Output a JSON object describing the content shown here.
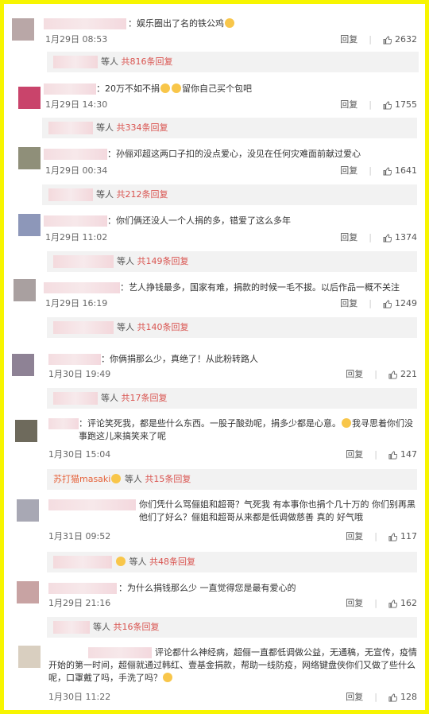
{
  "actions": {
    "reply_label": "回复"
  },
  "comments": [
    {
      "text": "：娱乐圈出了名的铁公鸡",
      "time": "1月29日 08:53",
      "likes": "2632",
      "reply_suffix": "等人",
      "reply_count": "共816条回复",
      "avatar_color": "#b9a7a7"
    },
    {
      "text": "：20万不如不捐",
      "text2": "留你自己买个包吧",
      "time": "1月29日 14:30",
      "likes": "1755",
      "reply_suffix": "等人",
      "reply_count": "共334条回复",
      "avatar_color": "#c9446b"
    },
    {
      "text": "：孙俪邓超这两口子扣的没点爱心，没见在任何灾难面前献过爱心",
      "time": "1月29日 00:34",
      "likes": "1641",
      "reply_suffix": "等人",
      "reply_count": "共212条回复",
      "avatar_color": "#8f8f79"
    },
    {
      "text": "：你们俩还没人一个人捐的多，错爱了这么多年",
      "time": "1月29日 11:02",
      "likes": "1374",
      "reply_suffix": "等人",
      "reply_count": "共149条回复",
      "avatar_color": "#8d97b9"
    },
    {
      "text": "：艺人挣钱最多，国家有难，捐款的时候一毛不拔。以后作品一概不关注",
      "time": "1月29日 16:19",
      "likes": "1249",
      "reply_suffix": "等人",
      "reply_count": "共140条回复",
      "avatar_color": "#a9a0a0"
    },
    {
      "text": "：你俩捐那么少，真绝了！从此粉转路人",
      "time": "1月30日 19:49",
      "likes": "221",
      "reply_suffix": "等人",
      "reply_count": "共17条回复",
      "avatar_color": "#8e8295"
    },
    {
      "text": "：评论笑死我，都是些什么东西。一股子酸劲呢，捐多少都是心意。",
      "text2": "我寻思着你们没事跑这儿来搞笑来了呢",
      "time": "1月30日 15:04",
      "likes": "147",
      "reply_name": "苏打猫masaki",
      "reply_suffix": "等人",
      "reply_count": "共15条回复",
      "avatar_color": "#6e6a5c"
    },
    {
      "text": "你们凭什么骂俪姐和超哥？气死我  有本事你也捐个几十万的  你们别再黑他们了好么？俪姐和超哥从来都是低调做慈善 真的  好气哦",
      "time": "1月31日 09:52",
      "likes": "117",
      "reply_suffix": "等人",
      "reply_count": "共48条回复",
      "avatar_color": "#a8a8b4"
    },
    {
      "text": "：为什么捐钱那么少  一直觉得您是最有爱心的",
      "time": "1月29日 21:16",
      "likes": "162",
      "reply_suffix": "等人",
      "reply_count": "共16条回复",
      "avatar_color": "#c8a3a3"
    },
    {
      "text": "评论都什么神经病，超俪一直都低调做公益，无通稿，无宣传，疫情开始的第一时间，超俪就通过韩红、壹基金捐款，帮助一线防疫，网络键盘侠你们又做了些什么呢，口罩戴了吗，手洗了吗？",
      "time": "1月30日 11:22",
      "likes": "128",
      "avatar_color": "#d9cfc0"
    }
  ]
}
